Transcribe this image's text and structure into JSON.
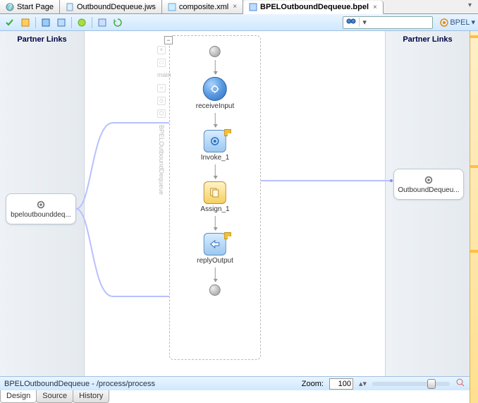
{
  "tabs": [
    {
      "label": "Start Page",
      "icon": "help"
    },
    {
      "label": "OutboundDequeue.jws",
      "icon": "file"
    },
    {
      "label": "composite.xml",
      "icon": "xml"
    },
    {
      "label": "BPELOutboundDequeue.bpel",
      "icon": "bpel",
      "active": true
    }
  ],
  "toolbar": {
    "search_placeholder": "",
    "bpel_label": "BPEL"
  },
  "panes": {
    "left_title": "Partner Links",
    "right_title": "Partner Links"
  },
  "flow": {
    "main_label": "main",
    "nodes": [
      {
        "type": "receive",
        "label": "receiveInput"
      },
      {
        "type": "invoke",
        "label": "Invoke_1",
        "flagged": true
      },
      {
        "type": "assign",
        "label": "Assign_1"
      },
      {
        "type": "reply",
        "label": "replyOutput",
        "flagged": true
      }
    ]
  },
  "partners": {
    "left": {
      "label": "bpeloutbounddeq..."
    },
    "right": {
      "label": "OutboundDequeu..."
    }
  },
  "footer": {
    "path": "BPELOutboundDequeue - /process/process",
    "zoom_label": "Zoom:",
    "zoom_value": "100"
  },
  "bottom_tabs": [
    "Design",
    "Source",
    "History"
  ],
  "active_bottom_tab": "Design"
}
